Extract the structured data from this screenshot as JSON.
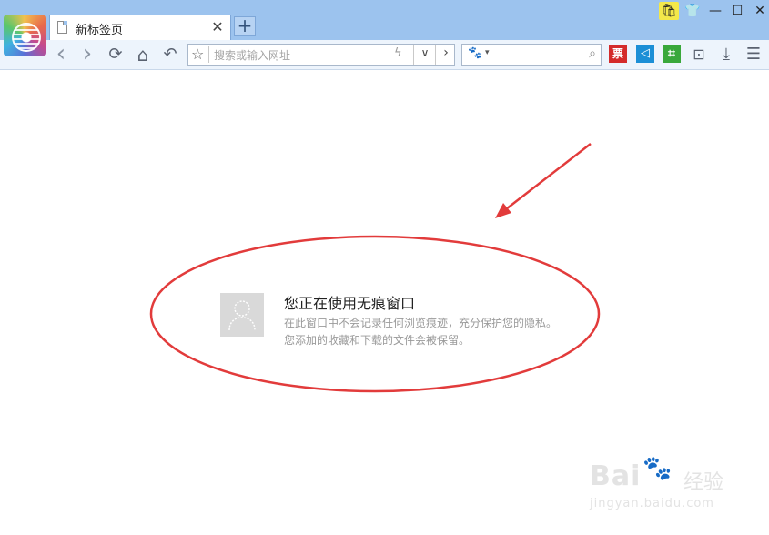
{
  "tab": {
    "title": "新标签页",
    "close": "✕",
    "new_tab": "+"
  },
  "window_controls": {
    "bag": "🛍",
    "shirt": "👕",
    "minimize": "—",
    "maximize": "☐",
    "close": "✕"
  },
  "toolbar": {
    "back": "‹",
    "forward": "›",
    "refresh": "⟳",
    "home": "⌂",
    "undo": "↶",
    "address_placeholder": "搜索或输入网址",
    "favorite": "☆",
    "bolt": "ϟ",
    "dropdown": "∨",
    "go": "›",
    "search_engine": "🐾",
    "search_caret": "▾",
    "search_icon": "⌕",
    "ext_ticket": "票",
    "ext_speaker": "◁",
    "ext_crop": "⌗",
    "fav_folder": "⊡",
    "download": "⤓",
    "menu": "☰"
  },
  "content": {
    "title": "您正在使用无痕窗口",
    "line1": "在此窗口中不会记录任何浏览痕迹，充分保护您的隐私。",
    "line2": "您添加的收藏和下载的文件会被保留。"
  },
  "watermark": {
    "brand": "Bai",
    "brand_cn": "经验",
    "url": "jingyan.baidu.com"
  },
  "colors": {
    "titlebar": "#9cc3ee",
    "annotation": "#e23b3b"
  }
}
